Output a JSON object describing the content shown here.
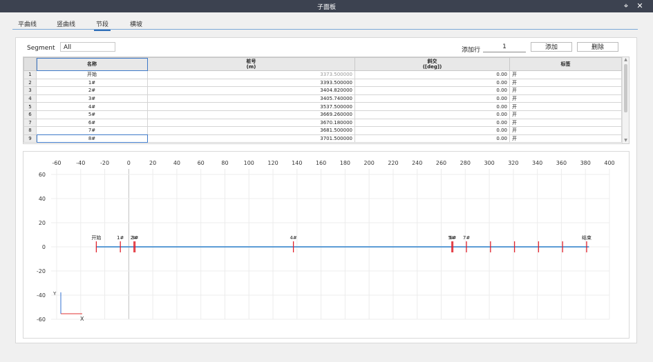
{
  "window": {
    "title": "子面板",
    "pin_icon": "pin-icon",
    "close_icon": "close-icon"
  },
  "tabs": [
    {
      "label": "平曲线",
      "active": false
    },
    {
      "label": "竖曲线",
      "active": false
    },
    {
      "label": "节段",
      "active": true
    },
    {
      "label": "横坡",
      "active": false
    }
  ],
  "toolbar": {
    "segment_label": "Segment",
    "segment_value": "All",
    "add_rows_label": "添加行",
    "add_rows_value": "1",
    "add_label": "添加",
    "delete_label": "删除"
  },
  "table": {
    "headers": {
      "name": "名称",
      "station": "桩号",
      "station_unit": "(m)",
      "skew": "斜交",
      "skew_unit": "([deg])",
      "tag": "标签"
    },
    "rows": [
      {
        "n": "1",
        "name": "开始",
        "station": "3373.500000",
        "skew": "0.00",
        "tag": "开"
      },
      {
        "n": "2",
        "name": "1#",
        "station": "3393.500000",
        "skew": "0.00",
        "tag": "开"
      },
      {
        "n": "3",
        "name": "2#",
        "station": "3404.820000",
        "skew": "0.00",
        "tag": "开"
      },
      {
        "n": "4",
        "name": "3#",
        "station": "3405.740000",
        "skew": "0.00",
        "tag": "开"
      },
      {
        "n": "5",
        "name": "4#",
        "station": "3537.500000",
        "skew": "0.00",
        "tag": "开"
      },
      {
        "n": "6",
        "name": "5#",
        "station": "3669.260000",
        "skew": "0.00",
        "tag": "开"
      },
      {
        "n": "7",
        "name": "6#",
        "station": "3670.180000",
        "skew": "0.00",
        "tag": "开"
      },
      {
        "n": "8",
        "name": "7#",
        "station": "3681.500000",
        "skew": "0.00",
        "tag": "开"
      },
      {
        "n": "9",
        "name": "8#",
        "station": "3701.500000",
        "skew": "0.00",
        "tag": "开"
      }
    ]
  },
  "chart_data": {
    "type": "line",
    "x_ticks": [
      -60,
      -40,
      -20,
      0,
      20,
      40,
      60,
      80,
      100,
      120,
      140,
      160,
      180,
      200,
      220,
      240,
      260,
      280,
      300,
      320,
      340,
      360,
      380,
      400
    ],
    "y_ticks": [
      60,
      40,
      20,
      0,
      -20,
      -40,
      -60
    ],
    "xlim": [
      -60,
      400
    ],
    "ylim": [
      -60,
      60
    ],
    "axis_x_label": "X",
    "axis_y_label": "Y",
    "line": {
      "x": [
        -27,
        383
      ],
      "y": [
        0,
        0
      ],
      "color": "#5b9bd5"
    },
    "markers": [
      {
        "x": -27,
        "label": "开始"
      },
      {
        "x": -7,
        "label": "1#"
      },
      {
        "x": 4.3,
        "label": "2#"
      },
      {
        "x": 5.2,
        "label": "3#"
      },
      {
        "x": 137,
        "label": "4#"
      },
      {
        "x": 268.8,
        "label": "5#"
      },
      {
        "x": 269.7,
        "label": "6#"
      },
      {
        "x": 281,
        "label": "7#"
      },
      {
        "x": 301,
        "label": ""
      },
      {
        "x": 321,
        "label": ""
      },
      {
        "x": 341,
        "label": ""
      },
      {
        "x": 361,
        "label": ""
      },
      {
        "x": 381,
        "label": "结束"
      }
    ],
    "marker_color": "#e0202a",
    "grid": true
  }
}
